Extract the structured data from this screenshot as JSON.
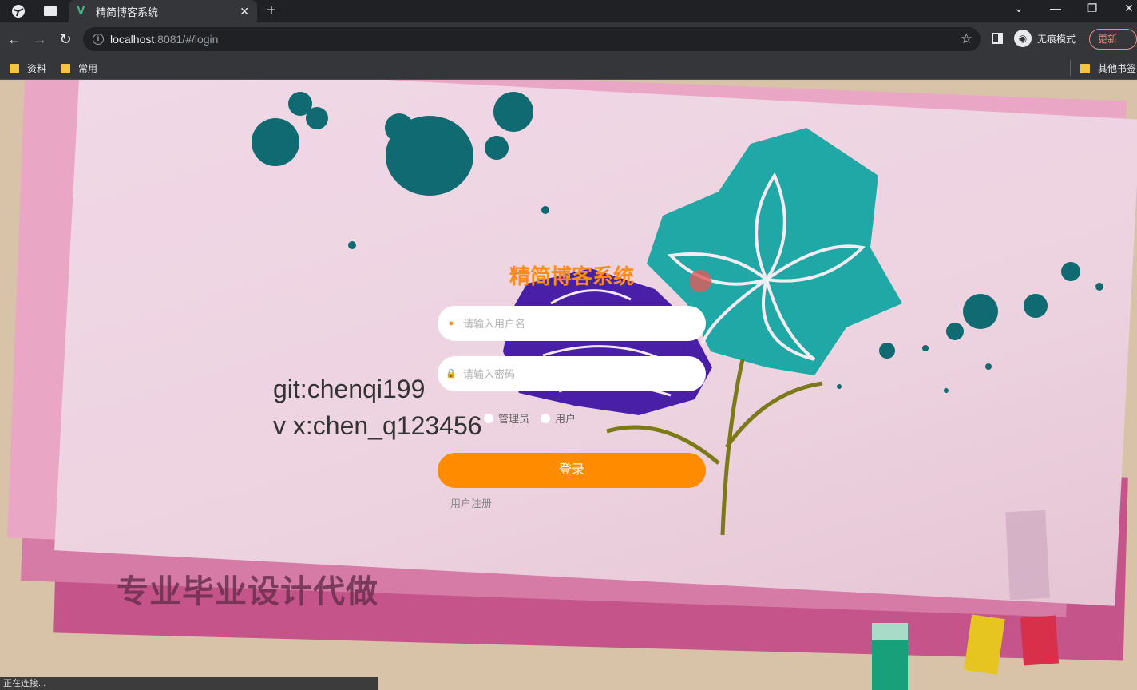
{
  "browser": {
    "tab": {
      "title": "精简博客系统",
      "favicon": "V"
    },
    "address": {
      "host": "localhost",
      "rest": ":8081/#/login"
    },
    "incognito_label": "无痕模式",
    "update_label": "更新",
    "bookmarks": [
      "资料",
      "常用"
    ],
    "other_bookmarks": "其他书签"
  },
  "page": {
    "login_title": "精简博客系统",
    "username_placeholder": "请输入用户名",
    "password_placeholder": "请输入密码",
    "roles": [
      "管理员",
      "用户"
    ],
    "login_label": "登录",
    "register_label": "用户注册",
    "watermark_lines": [
      "git:chenqi199",
      "v x:chen_q123456"
    ],
    "background_banner": "专业毕业设计代做"
  },
  "status_text": "正在连接...",
  "colors": {
    "accent": "#ff8c00",
    "title": "#ff8c1a"
  }
}
